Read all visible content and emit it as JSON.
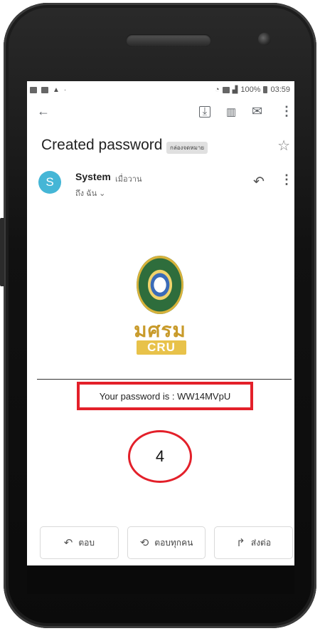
{
  "status": {
    "left_icons": [
      "photo-icon",
      "message-icon",
      "warning-icon",
      "dot-icon"
    ],
    "battery": "100%",
    "time": "03:59"
  },
  "toolbar": {
    "back": "←",
    "archive": "⤓",
    "delete": "🗑",
    "mail": "✉",
    "more": "⋮"
  },
  "email": {
    "subject": "Created password",
    "label": "กล่องจดหมาย",
    "star": "☆",
    "sender_initial": "S",
    "sender_name": "System",
    "sender_time": "เมื่อวาน",
    "to": "ถึง ฉัน ⌄",
    "reply_icon": "↶",
    "more": "⋮",
    "logo_text": "มศรม",
    "logo_sub": "CRU",
    "password_line": "Your password is : WW14MVpU",
    "step_marker": "4"
  },
  "actions": [
    {
      "icon": "↶",
      "label": "ตอบ"
    },
    {
      "icon": "⟲",
      "label": "ตอบทุกคน"
    },
    {
      "icon": "↱",
      "label": "ส่งต่อ"
    }
  ],
  "colors": {
    "accent_red": "#e3202a",
    "avatar": "#45b6d6"
  }
}
